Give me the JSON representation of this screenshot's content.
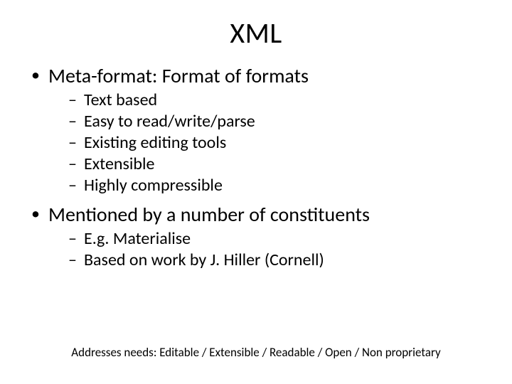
{
  "title": "XML",
  "bullets": [
    {
      "text": "Meta-format: Format of formats",
      "sub": [
        "Text based",
        "Easy to read/write/parse",
        "Existing editing tools",
        "Extensible",
        "Highly compressible"
      ]
    },
    {
      "text": "Mentioned by a number of constituents",
      "sub": [
        "E.g. Materialise",
        "Based on work by J. Hiller (Cornell)"
      ]
    }
  ],
  "footer": "Addresses needs: Editable / Extensible / Readable / Open / Non proprietary"
}
